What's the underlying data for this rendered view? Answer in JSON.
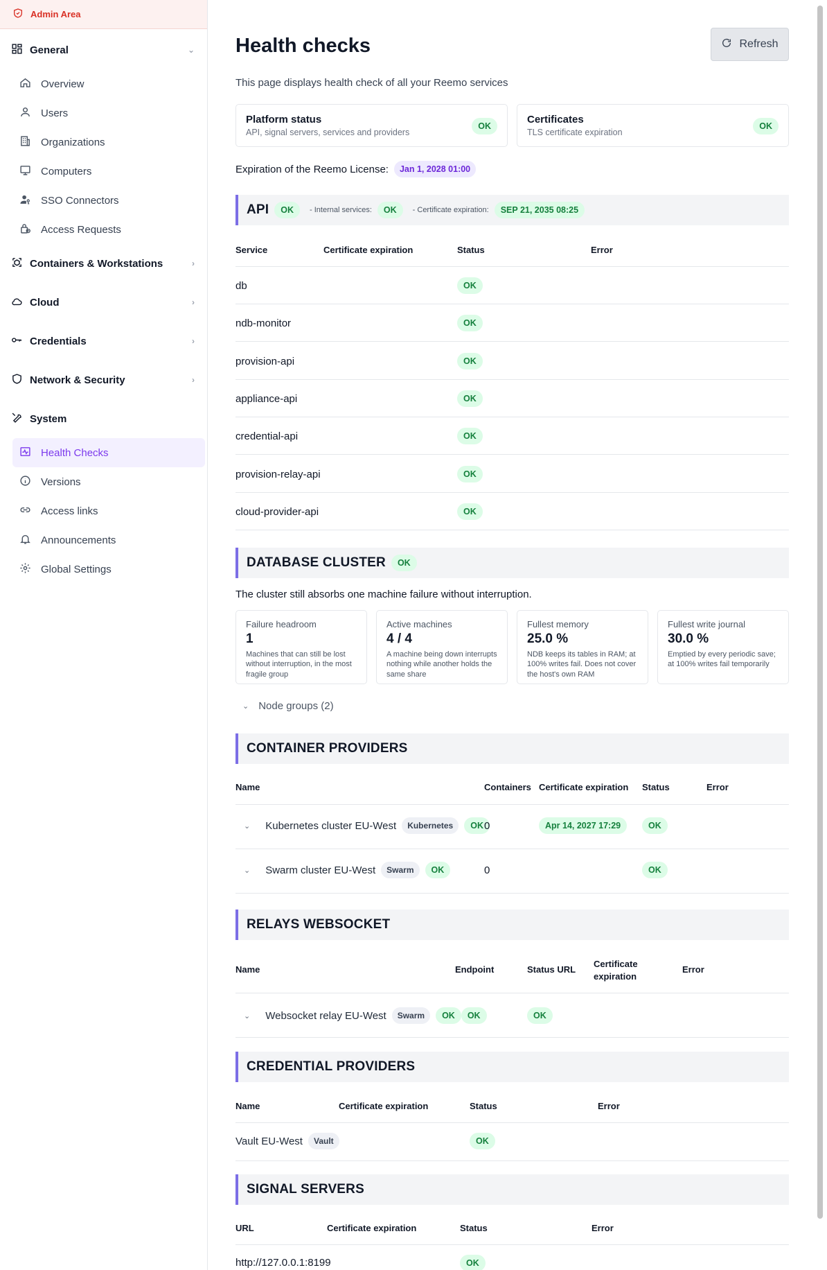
{
  "sidebar": {
    "admin_label": "Admin Area",
    "general": "General",
    "general_items": [
      "Overview",
      "Users",
      "Organizations",
      "Computers",
      "SSO Connectors",
      "Access Requests"
    ],
    "containers": "Containers & Workstations",
    "cloud": "Cloud",
    "credentials": "Credentials",
    "network": "Network & Security",
    "system": "System",
    "system_items": [
      "Health Checks",
      "Versions",
      "Access links",
      "Announcements",
      "Global Settings"
    ]
  },
  "header": {
    "title": "Health checks",
    "refresh": "Refresh",
    "subtitle": "This page displays health check of all your Reemo services"
  },
  "cards": {
    "platform_title": "Platform status",
    "platform_desc": "API, signal servers, services and providers",
    "platform_status": "OK",
    "cert_title": "Certificates",
    "cert_desc": "TLS certificate expiration",
    "cert_status": "OK"
  },
  "license": {
    "label": "Expiration of the Reemo License:",
    "date": "Jan 1, 2028 01:00"
  },
  "api": {
    "title": "API",
    "status": "OK",
    "internal_label": "- Internal services:",
    "internal_status": "OK",
    "cert_label": "- Certificate expiration:",
    "cert_date": "SEP 21, 2035 08:25",
    "columns": [
      "Service",
      "Certificate expiration",
      "Status",
      "Error"
    ],
    "rows": [
      {
        "service": "db",
        "status": "OK"
      },
      {
        "service": "ndb-monitor",
        "status": "OK"
      },
      {
        "service": "provision-api",
        "status": "OK"
      },
      {
        "service": "appliance-api",
        "status": "OK"
      },
      {
        "service": "credential-api",
        "status": "OK"
      },
      {
        "service": "provision-relay-api",
        "status": "OK"
      },
      {
        "service": "cloud-provider-api",
        "status": "OK"
      }
    ]
  },
  "db": {
    "title": "DATABASE CLUSTER",
    "status": "OK",
    "note": "The cluster still absorbs one machine failure without interruption.",
    "metrics": [
      {
        "label": "Failure headroom",
        "value": "1",
        "desc": "Machines that can still be lost without interruption, in the most fragile group"
      },
      {
        "label": "Active machines",
        "value": "4 / 4",
        "desc": "A machine being down interrupts nothing while another holds the same share"
      },
      {
        "label": "Fullest memory",
        "value": "25.0 %",
        "desc": "NDB keeps its tables in RAM; at 100% writes fail. Does not cover the host's own RAM"
      },
      {
        "label": "Fullest write journal",
        "value": "30.0 %",
        "desc": "Emptied by every periodic save; at 100% writes fail temporarily"
      }
    ],
    "node_groups": "Node groups (2)"
  },
  "containers": {
    "title": "CONTAINER PROVIDERS",
    "columns": [
      "Name",
      "Containers",
      "Certificate expiration",
      "Status",
      "Error"
    ],
    "rows": [
      {
        "name": "Kubernetes cluster EU-West",
        "tag": "Kubernetes",
        "ok": "OK",
        "count": "0",
        "cert": "Apr 14, 2027 17:29",
        "status": "OK"
      },
      {
        "name": "Swarm cluster EU-West",
        "tag": "Swarm",
        "ok": "OK",
        "count": "0",
        "cert": "",
        "status": "OK"
      }
    ]
  },
  "relays": {
    "title": "RELAYS WEBSOCKET",
    "columns": [
      "Name",
      "Endpoint",
      "Status URL",
      "Certificate",
      "expiration",
      "Error"
    ],
    "rows": [
      {
        "name": "Websocket relay EU-West",
        "tag": "Swarm",
        "ok1": "OK",
        "ok2": "OK",
        "status": "OK"
      }
    ]
  },
  "credentials": {
    "title": "CREDENTIAL PROVIDERS",
    "columns": [
      "Name",
      "Certificate expiration",
      "Status",
      "Error"
    ],
    "rows": [
      {
        "name": "Vault EU-West",
        "tag": "Vault",
        "status": "OK"
      }
    ]
  },
  "signal": {
    "title": "SIGNAL SERVERS",
    "columns": [
      "URL",
      "Certificate expiration",
      "Status",
      "Error"
    ],
    "rows": [
      {
        "url": "http://127.0.0.1:8199",
        "status": "OK"
      }
    ]
  }
}
